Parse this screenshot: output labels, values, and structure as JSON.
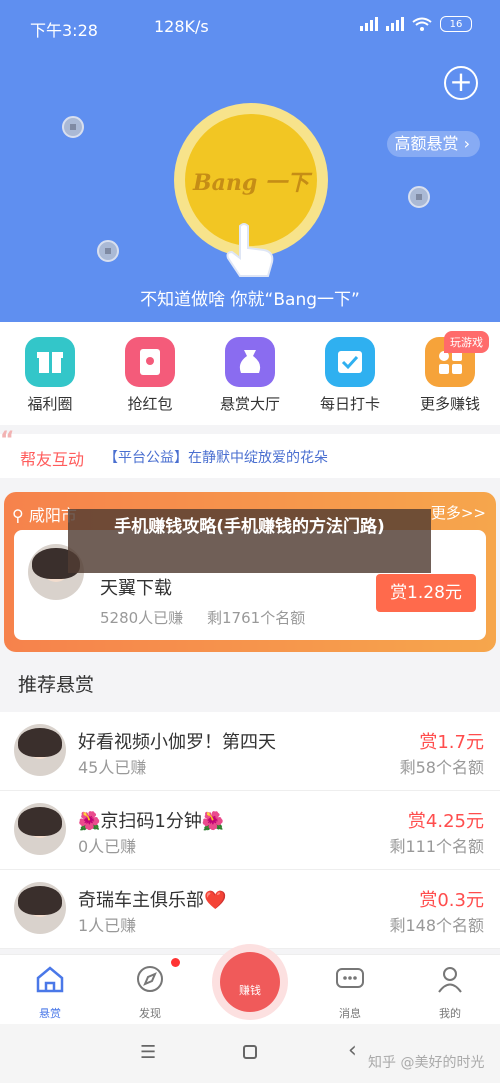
{
  "status": {
    "time": "下午3:28",
    "speed": "128K/s",
    "battery": "16"
  },
  "hero": {
    "reward_link": "高额悬赏",
    "coin_text": "Bang 一下",
    "tagline": "不知道做啥 你就“Bang一下”",
    "bg_color": "#5f8ff0"
  },
  "icons": [
    {
      "label": "福利圈",
      "icon": "gift-icon",
      "color": "#33c6c9"
    },
    {
      "label": "抢红包",
      "icon": "red-packet-icon",
      "color": "#f45b7a"
    },
    {
      "label": "悬赏大厅",
      "icon": "money-bag-icon",
      "color": "#8a6cf0"
    },
    {
      "label": "每日打卡",
      "icon": "calendar-check-icon",
      "color": "#2fb0f0"
    },
    {
      "label": "更多赚钱",
      "icon": "grid-icon",
      "color": "#f6a33a"
    }
  ],
  "badge_play": "玩游戏",
  "notice": {
    "title": "帮友互动",
    "text": "【平台公益】在静默中绽放爱的花朵"
  },
  "location": {
    "city": "咸阳市",
    "more": "更多>>",
    "name": "天翼下载",
    "stats": "5280人已赚     剩1761个名额",
    "reward": "赏1.28元"
  },
  "overlay_title": "手机赚钱攻略(手机赚钱的方法门路)",
  "section_title": "推荐悬赏",
  "rows": [
    {
      "title": "好看视频小伽罗！第四天",
      "sub": "45人已赚",
      "reward": "赏1.7元",
      "remain": "剩58个名额"
    },
    {
      "title": "🌺京扫码1分钟🌺",
      "sub": "0人已赚",
      "reward": "赏4.25元",
      "remain": "剩111个名额"
    },
    {
      "title": "奇瑞车主俱乐部❤️",
      "sub": "1人已赚",
      "reward": "赏0.3元",
      "remain": "剩148个名额"
    }
  ],
  "tabs": [
    {
      "label": "悬赏",
      "icon": "home-icon"
    },
    {
      "label": "发现",
      "icon": "discover-icon"
    },
    {
      "label": "赚钱",
      "icon": "red-envelope-icon"
    },
    {
      "label": "消息",
      "icon": "chat-icon"
    },
    {
      "label": "我的",
      "icon": "user-icon"
    }
  ],
  "watermark": "知乎 @美好的时光",
  "nav": {
    "menu": "☰",
    "back": "‹"
  }
}
